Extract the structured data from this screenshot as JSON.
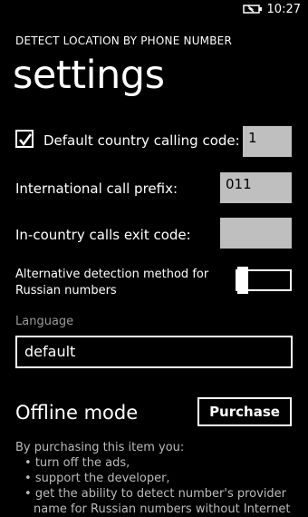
{
  "status_bar": {
    "time": "10:27",
    "battery_icon": "battery-charging-icon"
  },
  "app_title": "DETECT LOCATION BY PHONE NUMBER",
  "page_title": "settings",
  "default_country": {
    "checked": true,
    "label": "Default country calling code:",
    "value": "1"
  },
  "international_prefix": {
    "label": "International call prefix:",
    "value": "011"
  },
  "in_country_exit": {
    "label": "In-country calls exit code:",
    "value": ""
  },
  "alternative_detection": {
    "label_line1": "Alternative detection method for",
    "label_line2": "Russian numbers",
    "on": false
  },
  "language": {
    "label": "Language",
    "value": "default"
  },
  "offline": {
    "title": "Offline mode",
    "purchase_label": "Purchase",
    "intro": "By purchasing this item you:",
    "bullets": [
      "turn off the ads,",
      "support the developer,",
      "get the ability to detect number's provider",
      "name for Russian numbers without Internet"
    ]
  }
}
